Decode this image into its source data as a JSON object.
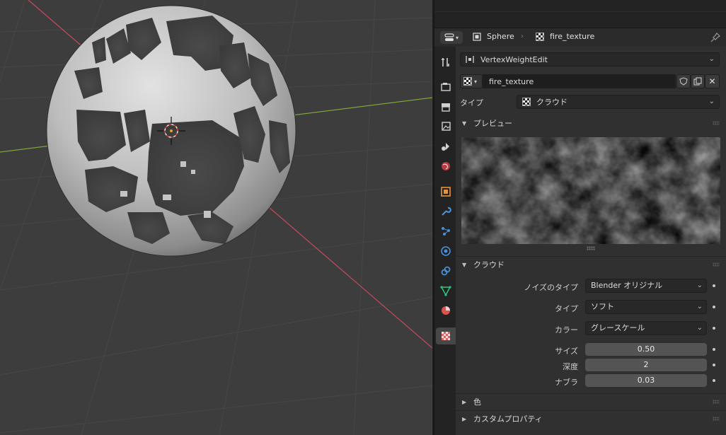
{
  "viewport": {
    "axis_colors": {
      "x_axis": "#c54b5c",
      "y_axis": "#7da33d"
    },
    "background": "#3d3d3d"
  },
  "header": {
    "object_name": "Sphere",
    "texture_name": "fire_texture",
    "editor_icon": "properties-editor-icon",
    "pin_icon": "pin-icon"
  },
  "tabs": [
    {
      "name": "tool",
      "icon": "tool-icon",
      "color": "#cfcfcf"
    },
    {
      "name": "render",
      "icon": "render-icon",
      "color": "#cfcfcf"
    },
    {
      "name": "output",
      "icon": "output-icon",
      "color": "#cfcfcf"
    },
    {
      "name": "view-layer",
      "icon": "view-layer-icon",
      "color": "#cfcfcf"
    },
    {
      "name": "scene",
      "icon": "scene-icon",
      "color": "#cfcfcf"
    },
    {
      "name": "world",
      "icon": "world-icon",
      "color": "#d9534f"
    },
    {
      "name": "object",
      "icon": "object-icon",
      "color": "#e8923a"
    },
    {
      "name": "modifiers",
      "icon": "wrench-icon",
      "color": "#4a90d9"
    },
    {
      "name": "particles",
      "icon": "particles-icon",
      "color": "#4a90d9"
    },
    {
      "name": "physics",
      "icon": "physics-icon",
      "color": "#4a90d9"
    },
    {
      "name": "constraints",
      "icon": "constraints-icon",
      "color": "#4a90d9"
    },
    {
      "name": "data",
      "icon": "mesh-data-icon",
      "color": "#33c27a"
    },
    {
      "name": "material",
      "icon": "material-icon",
      "color": "#d9534f"
    },
    {
      "name": "texture",
      "icon": "texture-icon",
      "color": "#e06060"
    }
  ],
  "context": {
    "user_dropdown": "VertexWeightEdit",
    "texture_field": "fire_texture",
    "type_label": "タイプ",
    "type_value": "クラウド"
  },
  "preview_panel": {
    "title": "プレビュー"
  },
  "clouds_panel": {
    "title": "クラウド",
    "noise_type_label": "ノイズのタイプ",
    "noise_type_value": "Blender オリジナル",
    "type_label": "タイプ",
    "type_value": "ソフト",
    "color_label": "カラー",
    "color_value": "グレースケール",
    "size_label": "サイズ",
    "size_value": "0.50",
    "depth_label": "深度",
    "depth_value": "2",
    "nabla_label": "ナブラ",
    "nabla_value": "0.03"
  },
  "collapsed_panels": {
    "colors": "色",
    "custom_props": "カスタムプロパティ"
  },
  "accent": "#4a90d9"
}
